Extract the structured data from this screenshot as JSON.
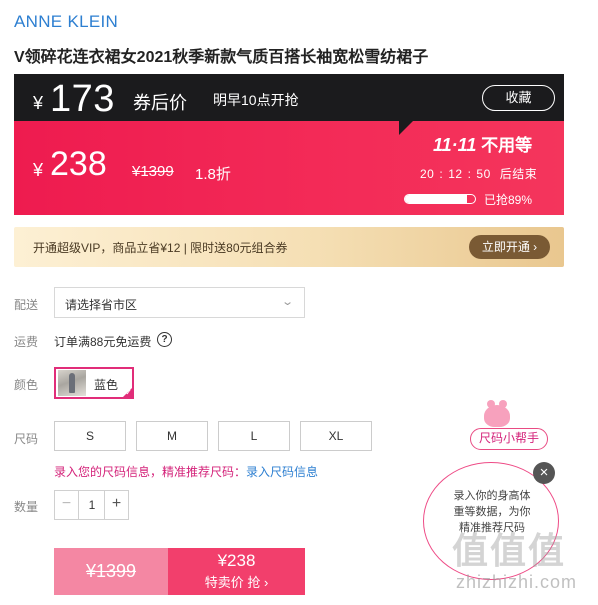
{
  "brand": "ANNE KLEIN",
  "title": "V领碎花连衣裙女2021秋季新款气质百搭长袖宽松雪纺裙子",
  "coupon_bar": {
    "currency": "¥",
    "price": "173",
    "label": "券后价",
    "notice": "明早10点开抢",
    "favorite_label": "收藏"
  },
  "red_bar": {
    "currency": "¥",
    "price": "238",
    "original_price": "¥1399",
    "discount": "1.8折",
    "promo_title_bold": "11·11",
    "promo_title_rest": "不用等",
    "countdown": {
      "h": "20",
      "m": "12",
      "s": "50",
      "suffix": "后结束"
    },
    "progress_text": "已抢89%",
    "progress_percent": 89
  },
  "vip": {
    "text": "开通超级VIP，商品立省¥12 | 限时送80元组合券",
    "button_label": "立即开通 ›"
  },
  "delivery": {
    "label": "配送",
    "placeholder": "请选择省市区",
    "chevron": "⌄"
  },
  "shipping": {
    "label": "运费",
    "text": "订单满88元免运费",
    "help": "?"
  },
  "color": {
    "label": "颜色",
    "option": "蓝色"
  },
  "size": {
    "label": "尺码",
    "options": [
      "S",
      "M",
      "L",
      "XL"
    ],
    "hint_prefix": "录入您的尺码信息，精准推荐尺码：",
    "hint_link": "录入尺码信息"
  },
  "quantity": {
    "label": "数量",
    "value": "1",
    "minus": "−",
    "plus": "+"
  },
  "buy": {
    "original_label": "¥1399",
    "price_label": "¥238",
    "action_label": "特卖价 抢 ›"
  },
  "size_helper": {
    "button_label": "尺码小帮手",
    "bubble_line1": "录入你的身高体",
    "bubble_line2": "重等数据，为你",
    "bubble_line3": "精准推荐尺码",
    "close": "×"
  },
  "watermark": {
    "glyphs": "值值值",
    "url": "zhizhizhi.com"
  },
  "colors": {
    "accent": "#f23f6c",
    "brand_blue": "#2d7fd1",
    "dark": "#1b1b1d",
    "pink": "#e12d79",
    "vip_btn": "#7a5a34"
  },
  "icons": {
    "help": "question-circle-icon",
    "chevron": "chevron-down-icon",
    "close": "close-icon",
    "check": "check-icon"
  }
}
